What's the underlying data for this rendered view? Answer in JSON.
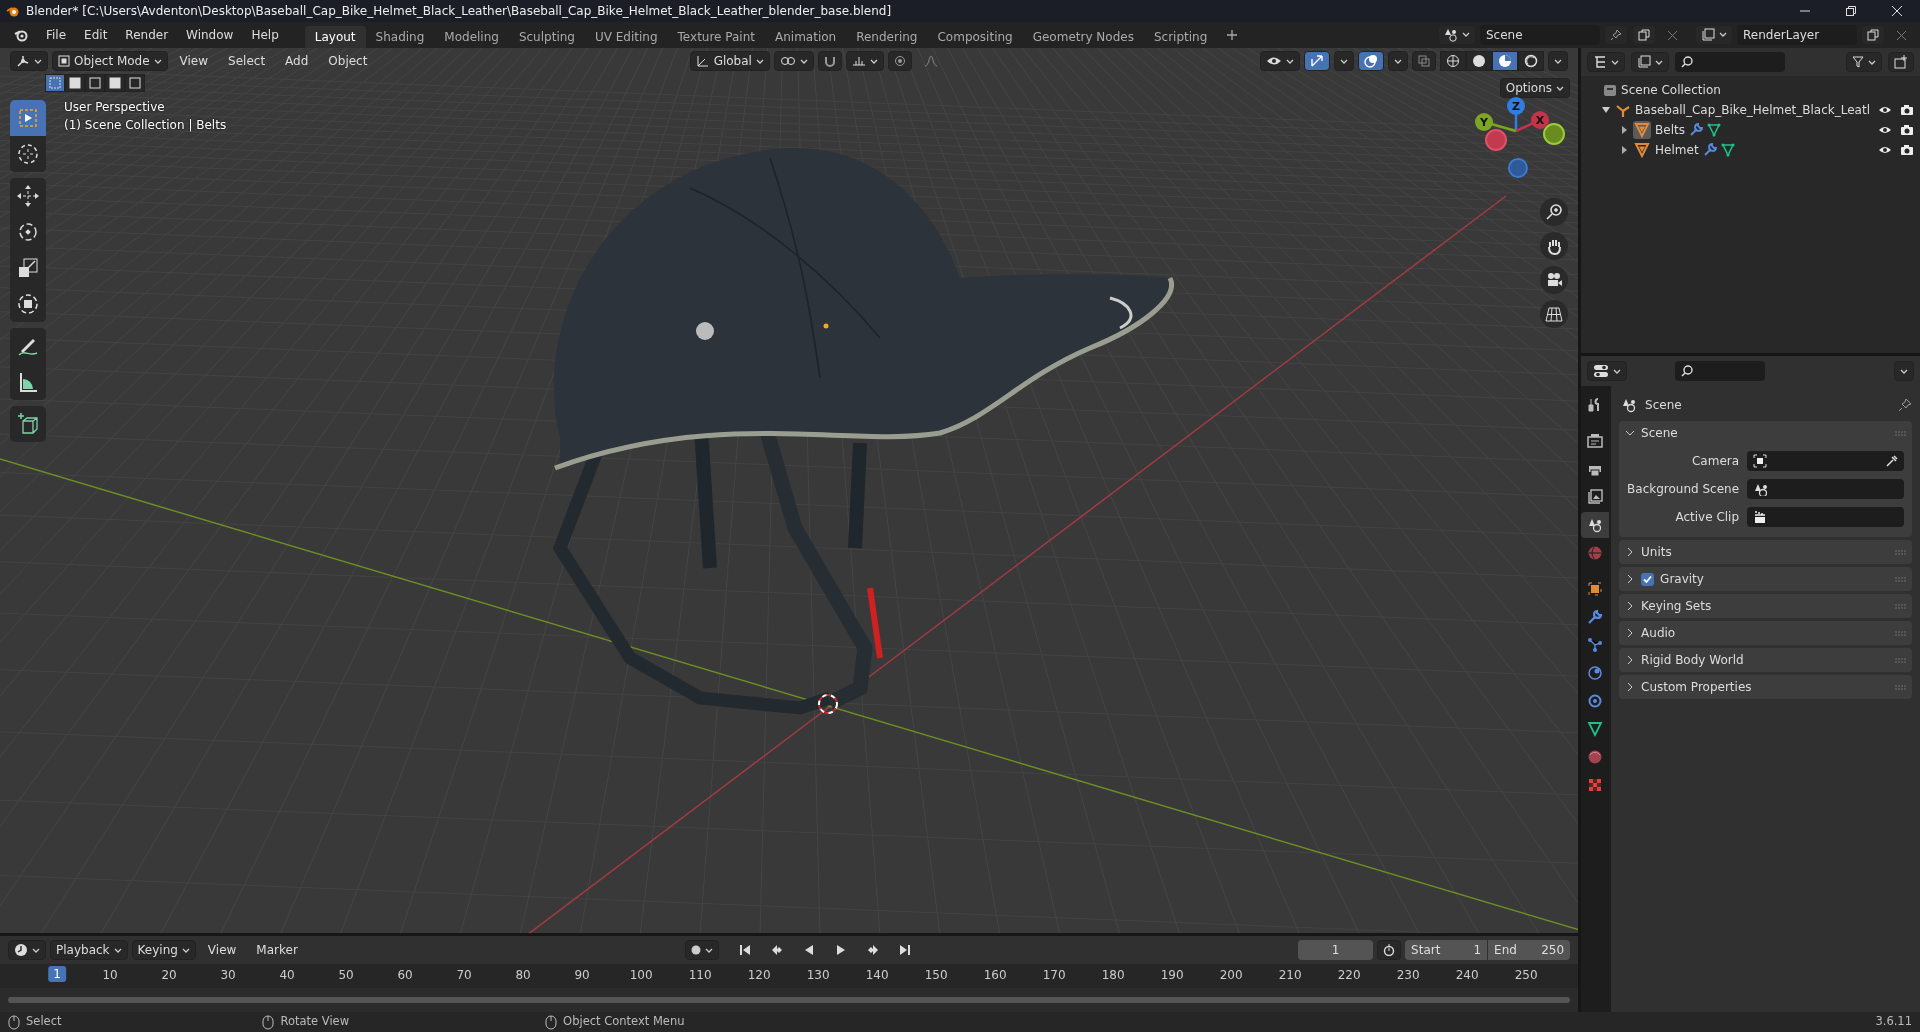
{
  "window": {
    "title": "Blender* [C:\\Users\\Avdenton\\Desktop\\Baseball_Cap_Bike_Helmet_Black_Leather\\Baseball_Cap_Bike_Helmet_Black_Leather_blender_base.blend]"
  },
  "menu": [
    "File",
    "Edit",
    "Render",
    "Window",
    "Help"
  ],
  "workspaces": [
    {
      "label": "Layout",
      "selected": true
    },
    {
      "label": "Shading",
      "selected": false
    },
    {
      "label": "Modeling",
      "selected": false
    },
    {
      "label": "Sculpting",
      "selected": false
    },
    {
      "label": "UV Editing",
      "selected": false
    },
    {
      "label": "Texture Paint",
      "selected": false
    },
    {
      "label": "Animation",
      "selected": false
    },
    {
      "label": "Rendering",
      "selected": false
    },
    {
      "label": "Compositing",
      "selected": false
    },
    {
      "label": "Geometry Nodes",
      "selected": false
    },
    {
      "label": "Scripting",
      "selected": false
    }
  ],
  "scene": {
    "name": "Scene"
  },
  "view_layer": {
    "name": "RenderLayer"
  },
  "viewport": {
    "mode": "Object Mode",
    "menus": [
      "View",
      "Select",
      "Add",
      "Object"
    ],
    "orientation": "Global",
    "select_modes": [
      {
        "selected": true
      },
      {
        "selected": false
      },
      {
        "selected": false
      },
      {
        "selected": false
      },
      {
        "selected": false
      }
    ],
    "gizmos_on": true,
    "overlays_on": true,
    "shading": [
      {
        "selected": false
      },
      {
        "selected": false
      },
      {
        "selected": true
      },
      {
        "selected": false
      }
    ],
    "options": "Options",
    "info": [
      "User Perspective",
      "(1) Scene Collection | Belts"
    ],
    "tool_groups": [
      {
        "tools": [
          {
            "kind": "select",
            "selected": true
          },
          {
            "kind": "cursor",
            "selected": false
          }
        ]
      },
      {
        "tools": [
          {
            "kind": "move",
            "selected": false
          },
          {
            "kind": "rotate",
            "selected": false
          },
          {
            "kind": "scale",
            "selected": false
          },
          {
            "kind": "transform",
            "selected": false
          }
        ]
      },
      {
        "tools": [
          {
            "kind": "annotate",
            "selected": false
          },
          {
            "kind": "measure",
            "selected": false
          }
        ]
      },
      {
        "tools": [
          {
            "kind": "add",
            "selected": false
          }
        ]
      }
    ],
    "axes": [
      {
        "label": "Z"
      },
      {
        "label": "Y"
      },
      {
        "label": "X"
      }
    ]
  },
  "outliner": {
    "root": "Scene Collection",
    "items": [
      {
        "label": "Baseball_Cap_Bike_Helmet_Black_Leatl",
        "expanded": true,
        "selected": false,
        "children": [
          {
            "label": "Belts",
            "expanded": false,
            "selected": true
          },
          {
            "label": "Helmet",
            "expanded": false,
            "selected": false
          }
        ]
      }
    ]
  },
  "properties": {
    "tab_groups": [
      {
        "tabs": [
          {
            "kind": "tool",
            "selected": false
          }
        ]
      },
      {
        "tabs": [
          {
            "kind": "render",
            "selected": false
          },
          {
            "kind": "output",
            "selected": false
          },
          {
            "kind": "viewlayer",
            "selected": false
          },
          {
            "kind": "scene",
            "selected": true
          },
          {
            "kind": "world",
            "selected": false
          }
        ]
      },
      {
        "tabs": [
          {
            "kind": "object",
            "selected": false
          },
          {
            "kind": "modifiers",
            "selected": false
          },
          {
            "kind": "particles",
            "selected": false
          },
          {
            "kind": "physics",
            "selected": false
          },
          {
            "kind": "constraints",
            "selected": false
          },
          {
            "kind": "data",
            "selected": false
          },
          {
            "kind": "material",
            "selected": false
          },
          {
            "kind": "texture",
            "selected": false
          }
        ]
      }
    ],
    "context": "Scene",
    "panels": [
      {
        "title": "Scene",
        "kind": "plain",
        "expanded": true,
        "fields": [
          {
            "label": "Camera",
            "kind": "camera"
          },
          {
            "label": "Background Scene",
            "kind": "scene"
          },
          {
            "label": "Active Clip",
            "kind": "clip"
          }
        ]
      },
      {
        "title": "Units",
        "kind": "plain",
        "expanded": false
      },
      {
        "title": "Gravity",
        "kind": "toggle",
        "checked": true,
        "expanded": false
      },
      {
        "title": "Keying Sets",
        "kind": "plain",
        "expanded": false
      },
      {
        "title": "Audio",
        "kind": "plain",
        "expanded": false
      },
      {
        "title": "Rigid Body World",
        "kind": "plain",
        "expanded": false
      },
      {
        "title": "Custom Properties",
        "kind": "plain",
        "expanded": false
      }
    ]
  },
  "timeline": {
    "menus": [
      "Playback",
      "Keying",
      "View",
      "Marker"
    ],
    "current_frame": "1",
    "start_label": "Start",
    "start": "1",
    "end_label": "End",
    "end": "250",
    "playhead": "1",
    "ticks": [
      "10",
      "20",
      "30",
      "40",
      "50",
      "60",
      "70",
      "80",
      "90",
      "100",
      "110",
      "120",
      "130",
      "140",
      "150",
      "160",
      "170",
      "180",
      "190",
      "200",
      "210",
      "220",
      "230",
      "240",
      "250"
    ]
  },
  "status_bar": {
    "hints": [
      "Select",
      "Rotate View",
      "Object Context Menu"
    ],
    "version": "3.6.11"
  }
}
